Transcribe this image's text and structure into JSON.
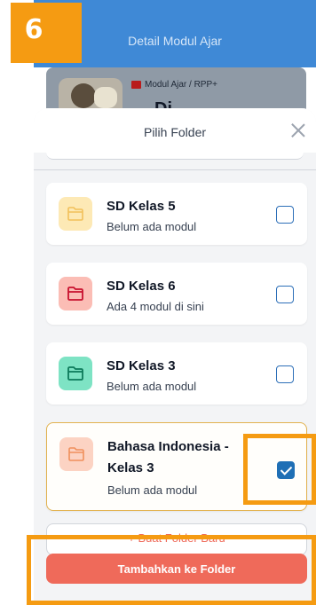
{
  "step": {
    "number": "6"
  },
  "header": {
    "title": "Detail Modul Ajar"
  },
  "background_card": {
    "tag": "Modul Ajar / RPP+",
    "partial_title": "Di"
  },
  "modal": {
    "title": "Pilih Folder",
    "folders": [
      {
        "name": "SD Kelas 5",
        "subtitle": "Belum ada modul",
        "icon_color": "#fde9b5",
        "icon_stroke": "#f2c05a",
        "checked": false,
        "icon": "folder-icon"
      },
      {
        "name": "SD Kelas 6",
        "subtitle": "Ada 4 modul di sini",
        "icon_color": "#fbbdb5",
        "icon_stroke": "#c8102e",
        "checked": false,
        "icon": "folder-icon"
      },
      {
        "name": "SD Kelas 3",
        "subtitle": "Belum ada modul",
        "icon_color": "#7ee3c4",
        "icon_stroke": "#0d7a5a",
        "checked": false,
        "icon": "folder-icon"
      },
      {
        "name": "Bahasa Indonesia - Kelas 3",
        "subtitle": "Belum ada modul",
        "icon_color": "#fcd3c3",
        "icon_stroke": "#f0905c",
        "checked": true,
        "icon": "folder-icon"
      }
    ],
    "new_folder_label": "+ Buat Folder Baru",
    "submit_label": "Tambahkan ke Folder"
  },
  "colors": {
    "accent": "#ef6a5a",
    "highlight": "#f59b12",
    "header": "#3f89d6",
    "checkbox": "#1f6fb5"
  }
}
